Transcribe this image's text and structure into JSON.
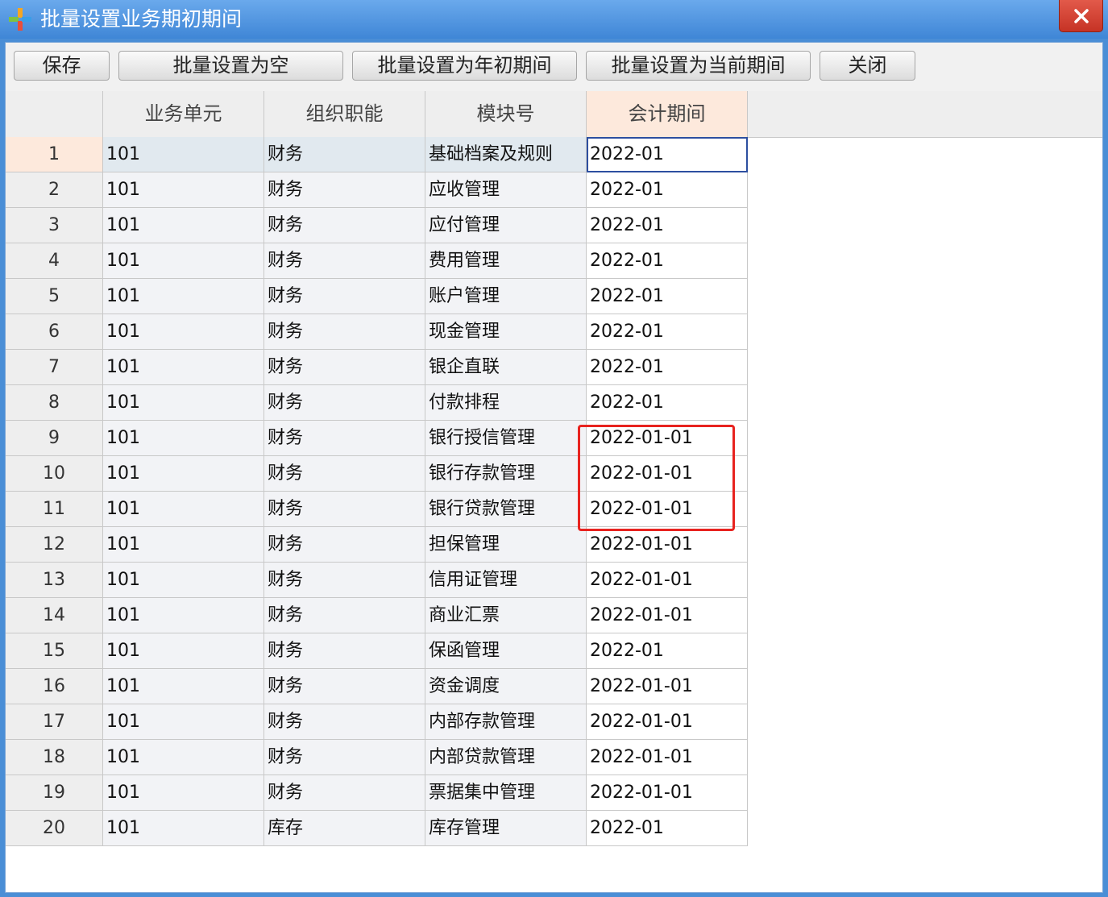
{
  "window": {
    "title": "批量设置业务期初期间",
    "icon": "app-logo-icon",
    "close_icon": "close-icon"
  },
  "toolbar": {
    "save": "保存",
    "set_empty": "批量设置为空",
    "set_year_start": "批量设置为年初期间",
    "set_current": "批量设置为当前期间",
    "close": "关闭"
  },
  "grid": {
    "headers": [
      "",
      "业务单元",
      "组织职能",
      "模块号",
      "会计期间"
    ],
    "rows": [
      {
        "no": "1",
        "unit": "101",
        "func": "财务",
        "module": "基础档案及规则",
        "period": "2022-01"
      },
      {
        "no": "2",
        "unit": "101",
        "func": "财务",
        "module": "应收管理",
        "period": "2022-01"
      },
      {
        "no": "3",
        "unit": "101",
        "func": "财务",
        "module": "应付管理",
        "period": "2022-01"
      },
      {
        "no": "4",
        "unit": "101",
        "func": "财务",
        "module": "费用管理",
        "period": "2022-01"
      },
      {
        "no": "5",
        "unit": "101",
        "func": "财务",
        "module": "账户管理",
        "period": "2022-01"
      },
      {
        "no": "6",
        "unit": "101",
        "func": "财务",
        "module": "现金管理",
        "period": "2022-01"
      },
      {
        "no": "7",
        "unit": "101",
        "func": "财务",
        "module": "银企直联",
        "period": "2022-01"
      },
      {
        "no": "8",
        "unit": "101",
        "func": "财务",
        "module": "付款排程",
        "period": "2022-01"
      },
      {
        "no": "9",
        "unit": "101",
        "func": "财务",
        "module": "银行授信管理",
        "period": "2022-01-01"
      },
      {
        "no": "10",
        "unit": "101",
        "func": "财务",
        "module": "银行存款管理",
        "period": "2022-01-01"
      },
      {
        "no": "11",
        "unit": "101",
        "func": "财务",
        "module": "银行贷款管理",
        "period": "2022-01-01"
      },
      {
        "no": "12",
        "unit": "101",
        "func": "财务",
        "module": "担保管理",
        "period": "2022-01-01"
      },
      {
        "no": "13",
        "unit": "101",
        "func": "财务",
        "module": "信用证管理",
        "period": "2022-01-01"
      },
      {
        "no": "14",
        "unit": "101",
        "func": "财务",
        "module": "商业汇票",
        "period": "2022-01-01"
      },
      {
        "no": "15",
        "unit": "101",
        "func": "财务",
        "module": "保函管理",
        "period": "2022-01"
      },
      {
        "no": "16",
        "unit": "101",
        "func": "财务",
        "module": "资金调度",
        "period": "2022-01-01"
      },
      {
        "no": "17",
        "unit": "101",
        "func": "财务",
        "module": "内部存款管理",
        "period": "2022-01-01"
      },
      {
        "no": "18",
        "unit": "101",
        "func": "财务",
        "module": "内部贷款管理",
        "period": "2022-01-01"
      },
      {
        "no": "19",
        "unit": "101",
        "func": "财务",
        "module": "票据集中管理",
        "period": "2022-01-01"
      },
      {
        "no": "20",
        "unit": "101",
        "func": "库存",
        "module": "库存管理",
        "period": "2022-01"
      }
    ]
  },
  "colors": {
    "title_bar": "#4a8ed6",
    "close_button": "#d2402f",
    "highlight": "#e8231f",
    "active_header": "#fde9dc"
  }
}
